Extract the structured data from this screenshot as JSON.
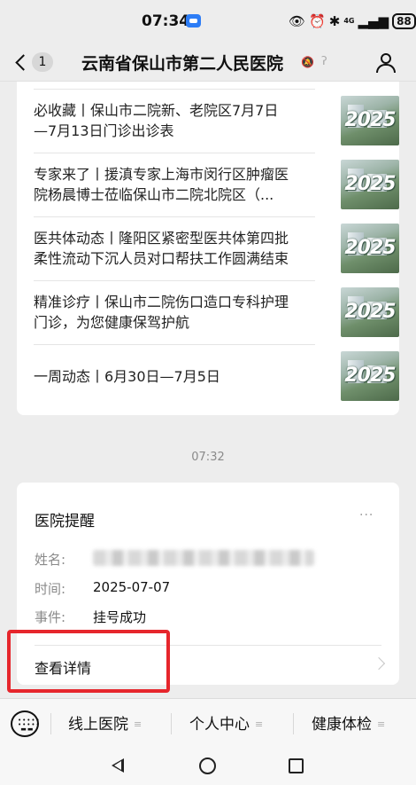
{
  "status_bar": {
    "time": "07:34",
    "network": "4G",
    "battery": "88"
  },
  "header": {
    "unread_count": "1",
    "title": "云南省保山市第二人民医院"
  },
  "articles": [
    {
      "line1": "必收藏丨保山市二院新、老院区7月7日",
      "line2": "—7月13日门诊出诊表",
      "thumb_text": "2025"
    },
    {
      "line1": "专家来了丨援滇专家上海市闵行区肿瘤医",
      "line2": "院杨晨博士莅临保山市二院北院区（...",
      "thumb_text": "2025"
    },
    {
      "line1": "医共体动态丨隆阳区紧密型医共体第四批",
      "line2": "柔性流动下沉人员对口帮扶工作圆满结束",
      "thumb_text": "2025"
    },
    {
      "line1": "精准诊疗丨保山市二院伤口造口专科护理",
      "line2": "门诊，为您健康保驾护航",
      "thumb_text": "2025"
    },
    {
      "line1": "一周动态丨6月30日—7月5日",
      "line2": "",
      "thumb_text": "2025"
    }
  ],
  "chat_time": "07:32",
  "notice": {
    "title": "医院提醒",
    "more": "···",
    "name_label": "姓名:",
    "name_value": "",
    "time_label": "时间:",
    "time_value": "2025-07-07",
    "event_label": "事件:",
    "event_value": "挂号成功",
    "detail_label": "查看详情"
  },
  "bottom_menu": {
    "items": [
      "线上医院",
      "个人中心",
      "健康体检"
    ]
  },
  "colors": {
    "highlight": "#e6262c",
    "status_app": "#2d7df6",
    "background": "#ededed"
  }
}
